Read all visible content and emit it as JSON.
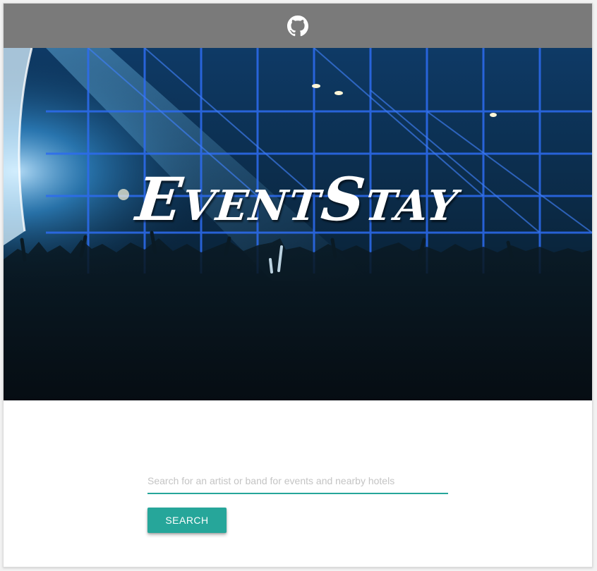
{
  "header": {
    "icon": "github-icon",
    "background_color": "#7a7a7a"
  },
  "hero": {
    "title": "EventStay"
  },
  "search": {
    "placeholder": "Search for an artist or band for events and nearby hotels",
    "value": "",
    "button_label": "SEARCH",
    "accent_color": "#26a69a"
  }
}
